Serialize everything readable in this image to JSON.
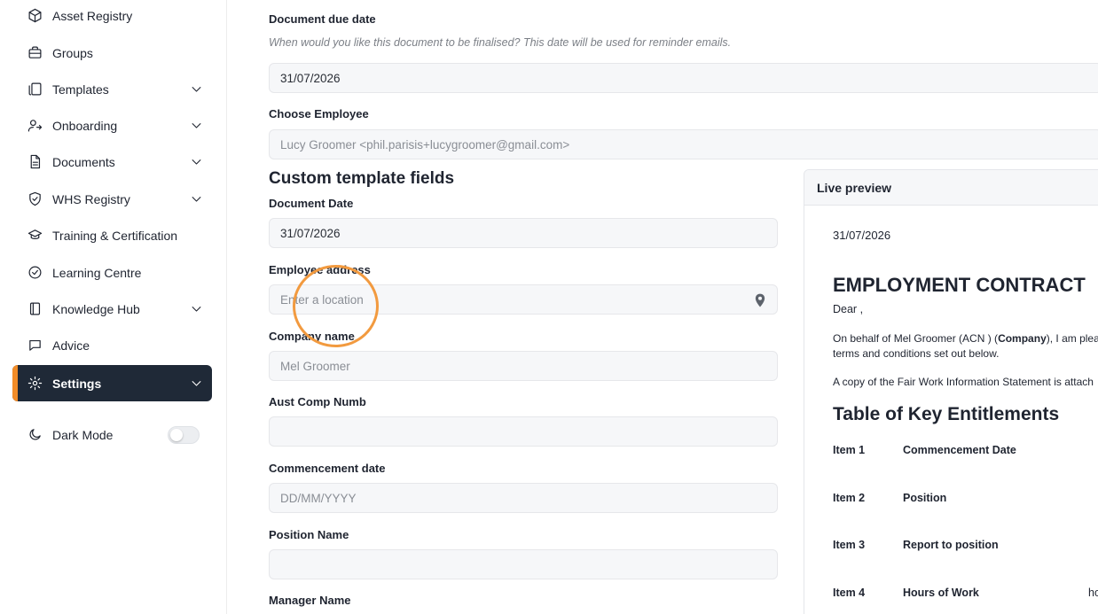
{
  "sidebar": {
    "items": [
      {
        "label": "Asset Registry",
        "icon": "cube-icon",
        "chevron": false
      },
      {
        "label": "Groups",
        "icon": "briefcase-icon",
        "chevron": false
      },
      {
        "label": "Templates",
        "icon": "copy-icon",
        "chevron": true
      },
      {
        "label": "Onboarding",
        "icon": "user-arrow-icon",
        "chevron": true
      },
      {
        "label": "Documents",
        "icon": "document-icon",
        "chevron": true
      },
      {
        "label": "WHS Registry",
        "icon": "shield-check-icon",
        "chevron": true
      },
      {
        "label": "Training & Certification",
        "icon": "graduation-cap-icon",
        "chevron": false
      },
      {
        "label": "Learning Centre",
        "icon": "check-circle-icon",
        "chevron": false
      },
      {
        "label": "Knowledge Hub",
        "icon": "book-icon",
        "chevron": true
      },
      {
        "label": "Advice",
        "icon": "chat-bubble-icon",
        "chevron": false
      },
      {
        "label": "Settings",
        "icon": "gear-icon",
        "chevron": true,
        "active": true
      }
    ],
    "dark_mode": {
      "label": "Dark Mode",
      "icon": "moon-icon",
      "enabled": false
    }
  },
  "form": {
    "due_date": {
      "label": "Document due date",
      "hint": "When would you like this document to be finalised? This date will be used for reminder emails.",
      "value": "31/07/2026"
    },
    "employee": {
      "label": "Choose Employee",
      "value": "Lucy Groomer <phil.parisis+lucygroomer@gmail.com>"
    },
    "custom_title": "Custom template fields",
    "document_date": {
      "label": "Document Date",
      "value": "31/07/2026"
    },
    "employee_address": {
      "label": "Employee address",
      "placeholder": "Enter a location"
    },
    "company_name": {
      "label": "Company name",
      "value": "Mel Groomer"
    },
    "aust_comp_numb": {
      "label": "Aust Comp Numb",
      "value": ""
    },
    "commencement_date": {
      "label": "Commencement date",
      "placeholder": "DD/MM/YYYY"
    },
    "position_name": {
      "label": "Position Name",
      "value": ""
    },
    "manager_name": {
      "label": "Manager Name"
    }
  },
  "preview": {
    "title": "Live preview",
    "date": "31/07/2026",
    "heading": "EMPLOYMENT CONTRACT",
    "dear": "Dear ,",
    "para1_a": "On behalf of Mel Groomer (ACN ) (",
    "para1_bold": "Company",
    "para1_b": "), I am pleas",
    "para1_line2": "terms and conditions set out below.",
    "para2": "A copy of the Fair Work Information Statement is attach",
    "table_heading": "Table of Key Entitlements",
    "items": [
      {
        "item": "Item 1",
        "label": "Commencement Date",
        "extra": ""
      },
      {
        "item": "Item 2",
        "label": "Position",
        "extra": ""
      },
      {
        "item": "Item 3",
        "label": "Report to position",
        "extra": ""
      },
      {
        "item": "Item 4",
        "label": "Hours of Work",
        "extra": "ho"
      }
    ]
  },
  "colors": {
    "accent": "#f28c28",
    "active_bg": "#1f2937"
  }
}
